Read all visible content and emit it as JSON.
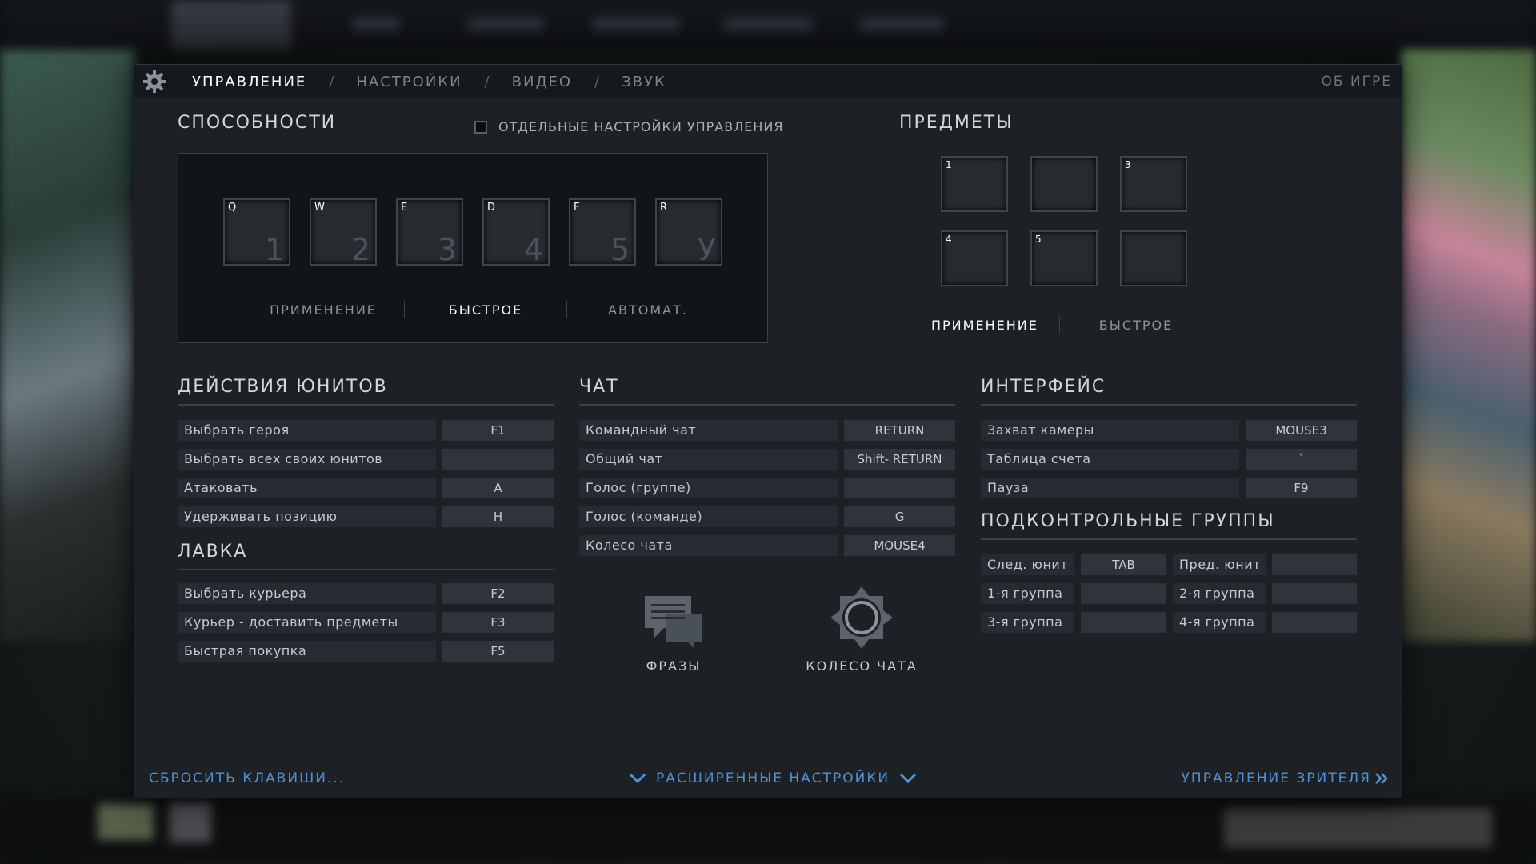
{
  "nav": {
    "tabs": [
      "УПРАВЛЕНИЕ",
      "НАСТРОЙКИ",
      "ВИДЕО",
      "ЗВУК"
    ],
    "separator": "/",
    "about": "ОБ ИГРЕ"
  },
  "abilities": {
    "title": "СПОСОБНОСТИ",
    "separate_controls_label": "ОТДЕЛЬНЫЕ НАСТРОЙКИ УПРАВЛЕНИЯ",
    "slots": [
      {
        "key": "Q",
        "num": "1"
      },
      {
        "key": "W",
        "num": "2"
      },
      {
        "key": "E",
        "num": "3"
      },
      {
        "key": "D",
        "num": "4"
      },
      {
        "key": "F",
        "num": "5"
      },
      {
        "key": "R",
        "num": "У"
      }
    ],
    "modes": [
      "ПРИМЕНЕНИЕ",
      "БЫСТРОЕ",
      "АВТОМАТ."
    ]
  },
  "items": {
    "title": "ПРЕДМЕТЫ",
    "slots": [
      "1",
      "",
      "3",
      "4",
      "5",
      ""
    ],
    "modes": [
      "ПРИМЕНЕНИЕ",
      "БЫСТРОЕ"
    ]
  },
  "unit_actions": {
    "title": "ДЕЙСТВИЯ ЮНИТОВ",
    "rows": [
      {
        "label": "Выбрать героя",
        "key": "F1"
      },
      {
        "label": "Выбрать всех своих юнитов",
        "key": ""
      },
      {
        "label": "Атаковать",
        "key": "A"
      },
      {
        "label": "Удерживать позицию",
        "key": "H"
      }
    ]
  },
  "shop": {
    "title": "ЛАВКА",
    "rows": [
      {
        "label": "Выбрать курьера",
        "key": "F2"
      },
      {
        "label": "Курьер - доставить предметы",
        "key": "F3"
      },
      {
        "label": "Быстрая покупка",
        "key": "F5"
      }
    ]
  },
  "chat": {
    "title": "ЧАТ",
    "rows": [
      {
        "label": "Командный чат",
        "key": "RETURN"
      },
      {
        "label": "Общий чат",
        "key": "Shift- RETURN"
      },
      {
        "label": "Голос (группе)",
        "key": ""
      },
      {
        "label": "Голос (команде)",
        "key": "G"
      },
      {
        "label": "Колесо чата",
        "key": "MOUSE4"
      }
    ],
    "phrases_label": "ФРАЗЫ",
    "wheel_label": "КОЛЕСО ЧАТА"
  },
  "interface": {
    "title": "ИНТЕРФЕЙС",
    "rows": [
      {
        "label": "Захват камеры",
        "key": "MOUSE3"
      },
      {
        "label": "Таблица счета",
        "key": "`"
      },
      {
        "label": "Пауза",
        "key": "F9"
      }
    ]
  },
  "control_groups": {
    "title": "ПОДКОНТРОЛЬНЫЕ ГРУППЫ",
    "rows": [
      {
        "label_a": "След. юнит",
        "key_a": "TAB",
        "label_b": "Пред. юнит",
        "key_b": ""
      },
      {
        "label_a": "1-я группа",
        "key_a": "",
        "label_b": "2-я группа",
        "key_b": ""
      },
      {
        "label_a": "3-я группа",
        "key_a": "",
        "label_b": "4-я группа",
        "key_b": ""
      }
    ]
  },
  "footer": {
    "reset": "СБРОСИТЬ КЛАВИШИ...",
    "advanced": "РАСШИРЕННЫЕ НАСТРОЙКИ",
    "spectator": "УПРАВЛЕНИЕ ЗРИТЕЛЯ"
  },
  "colors": {
    "accent": "#4e93d8",
    "panel": "#1d2126"
  }
}
